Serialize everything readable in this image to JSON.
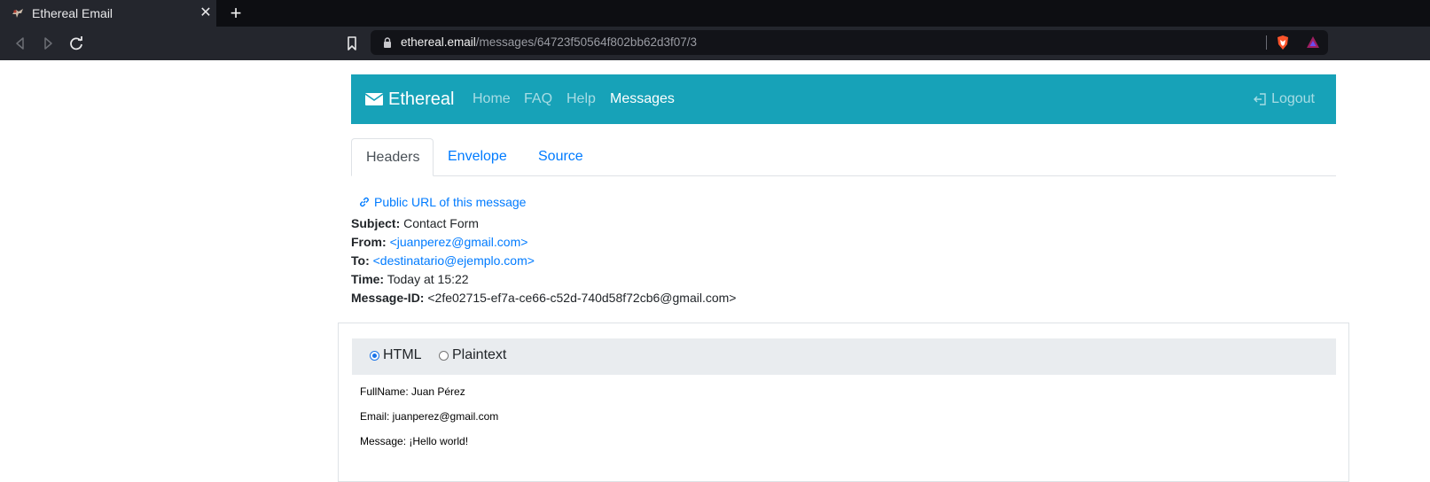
{
  "browser": {
    "tab_title": "Ethereal Email",
    "url_host": "ethereal.email",
    "url_path": "/messages/64723f50564f802bb62d3f07/3"
  },
  "navbar": {
    "brand": "Ethereal",
    "links": [
      "Home",
      "FAQ",
      "Help",
      "Messages"
    ],
    "active": "Messages",
    "logout": "Logout"
  },
  "tabs": [
    "Headers",
    "Envelope",
    "Source"
  ],
  "active_tab": "Headers",
  "public_url_label": "Public URL of this message",
  "headers": {
    "subject": {
      "label": "Subject:",
      "value": "Contact Form"
    },
    "from": {
      "label": "From:",
      "value": "<juanperez@gmail.com>"
    },
    "to": {
      "label": "To:",
      "value": "<destinatario@ejemplo.com>"
    },
    "time": {
      "label": "Time:",
      "value": "Today at 15:22"
    },
    "message_id": {
      "label": "Message-ID:",
      "value": "<2fe02715-ef7a-ce66-c52d-740d58f72cb6@gmail.com>"
    }
  },
  "format": {
    "options": [
      "HTML",
      "Plaintext"
    ],
    "selected": "HTML"
  },
  "body_lines": [
    "FullName: Juan Pérez",
    "Email: juanperez@gmail.com",
    "Message: ¡Hello world!"
  ],
  "colors": {
    "navbar": "#17a2b8",
    "link": "#007bff"
  }
}
